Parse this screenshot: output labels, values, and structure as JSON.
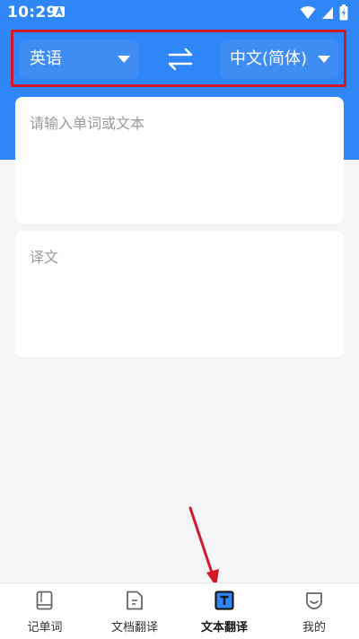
{
  "status": {
    "time": "10:29",
    "icons": [
      "notification-icon",
      "wifi-icon",
      "signal-icon",
      "battery-icon"
    ]
  },
  "language_bar": {
    "source_label": "英语",
    "target_label": "中文(简体)",
    "swap_icon": "swap-arrows-icon"
  },
  "input_card": {
    "placeholder": "请输入单词或文本"
  },
  "output_card": {
    "placeholder": "译文"
  },
  "nav": {
    "items": [
      {
        "label": "记单词",
        "icon": "book-icon"
      },
      {
        "label": "文档翻译",
        "icon": "document-icon"
      },
      {
        "label": "文本翻译",
        "icon": "text-translate-icon"
      },
      {
        "label": "我的",
        "icon": "profile-icon"
      }
    ],
    "active_index": 2
  },
  "colors": {
    "header_blue": "#2f86f6",
    "button_blue": "#3f8cf3",
    "highlight_red": "#d0192b",
    "background": "#f4f5f7"
  }
}
